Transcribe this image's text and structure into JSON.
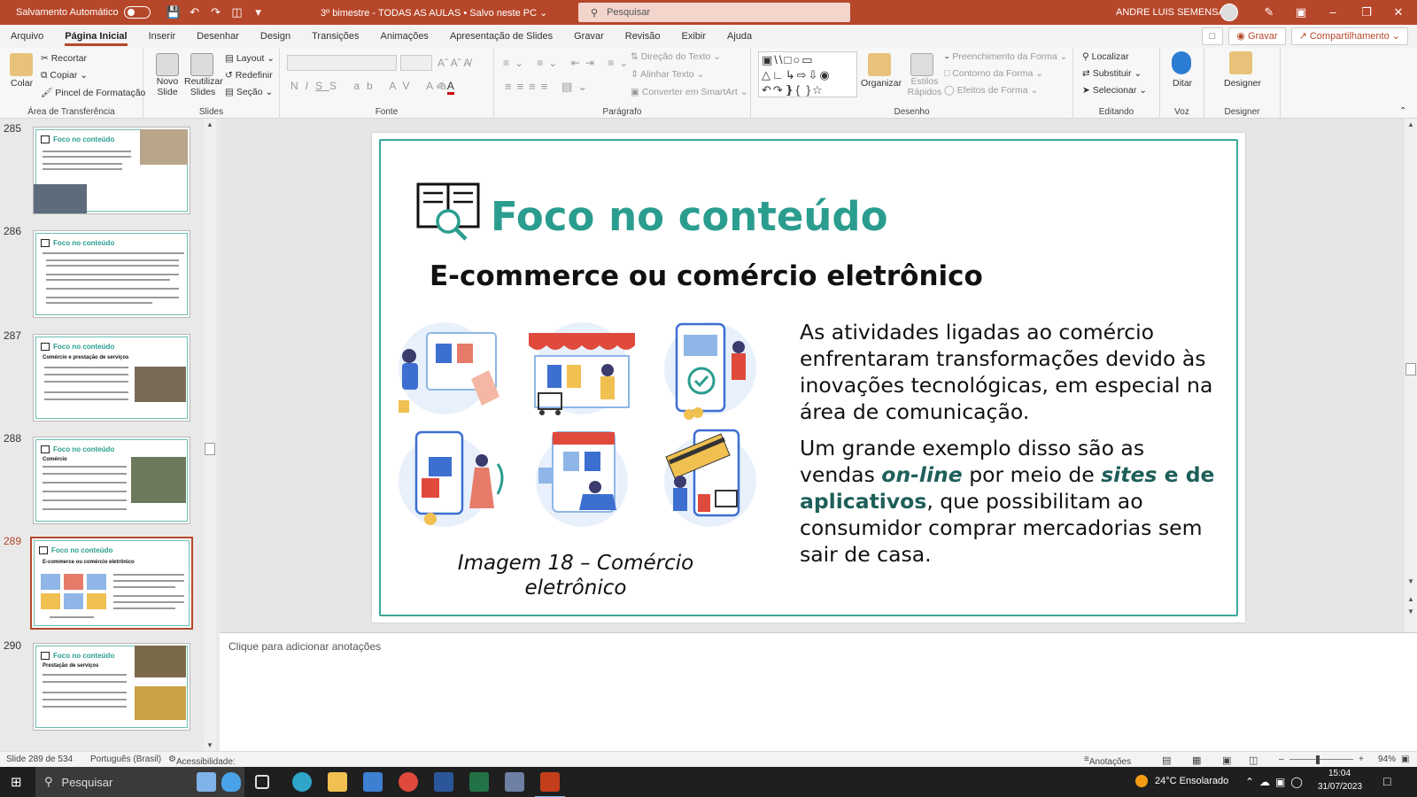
{
  "titlebar": {
    "autosave_label": "Salvamento Automático",
    "doc_title": "3º bimestre - TODAS AS AULAS • Salvo neste PC ⌄",
    "search_placeholder": "Pesquisar",
    "user_name": "ANDRE LUIS SEMENSATO"
  },
  "tabs": [
    "Arquivo",
    "Página Inicial",
    "Inserir",
    "Desenhar",
    "Design",
    "Transições",
    "Animações",
    "Apresentação de Slides",
    "Gravar",
    "Revisão",
    "Exibir",
    "Ajuda"
  ],
  "tab_actions": {
    "record": "Gravar",
    "share": "Compartilhamento"
  },
  "ribbon": {
    "clipboard": {
      "paste": "Colar",
      "cut": "Recortar",
      "copy": "Copiar",
      "format_painter": "Pincel de Formatação",
      "label": "Área de Transferência"
    },
    "slides": {
      "new_slide": "Novo Slide",
      "reuse": "Reutilizar Slides",
      "layout": "Layout",
      "reset": "Redefinir",
      "section": "Seção",
      "label": "Slides"
    },
    "font": {
      "label": "Fonte"
    },
    "paragraph": {
      "text_direction": "Direção do Texto",
      "align_text": "Alinhar Texto",
      "smartart": "Converter em SmartArt",
      "label": "Parágrafo"
    },
    "drawing": {
      "arrange": "Organizar",
      "quick_styles": "Estilos Rápidos",
      "fill": "Preenchimento da Forma",
      "outline": "Contorno da Forma",
      "effects": "Efeitos de Forma",
      "label": "Desenho"
    },
    "editing": {
      "find": "Localizar",
      "replace": "Substituir",
      "select": "Selecionar",
      "label": "Editando"
    },
    "voice": {
      "dictate": "Ditar",
      "label": "Voz"
    },
    "designer": {
      "designer": "Designer",
      "label": "Designer"
    }
  },
  "thumbnails": [
    {
      "num": "285",
      "title": "Foco no conteúdo",
      "subtitle": ""
    },
    {
      "num": "286",
      "title": "Foco no conteúdo",
      "subtitle": ""
    },
    {
      "num": "287",
      "title": "Foco no conteúdo",
      "subtitle": "Comércio e prestação de serviços"
    },
    {
      "num": "288",
      "title": "Foco no conteúdo",
      "subtitle": "Comércio"
    },
    {
      "num": "289",
      "title": "Foco no conteúdo",
      "subtitle": "E-commerce ou comércio eletrônico"
    },
    {
      "num": "290",
      "title": "Foco no conteúdo",
      "subtitle": "Prestação de serviços"
    }
  ],
  "slide": {
    "title": "Foco no conteúdo",
    "subtitle": "E-commerce ou comércio eletrônico",
    "para1": "As atividades ligadas ao comércio enfrentaram transformações devido às inovações tecnológicas, em especial na área de comunicação.",
    "para2_a": "Um grande exemplo disso são as vendas ",
    "para2_em1": "on-line",
    "para2_b": " por meio de ",
    "para2_em2": "sites",
    "para2_c": " e de aplicativos",
    "para2_d": ", que possibilitam ao consumidor comprar mercadorias sem sair de casa.",
    "caption": "Imagem 18 – Comércio eletrônico"
  },
  "notes_placeholder": "Clique para adicionar anotações",
  "status": {
    "slide_count": "Slide 289 de 534",
    "language": "Português (Brasil)",
    "accessibility": "Acessibilidade: investigar",
    "notes": "Anotações",
    "zoom": "94%"
  },
  "taskbar": {
    "search": "Pesquisar",
    "weather": "24°C  Ensolarado",
    "time": "15:04",
    "date": "31/07/2023"
  },
  "colors": {
    "accent": "#b7472a",
    "teal": "#2a9d8f"
  }
}
